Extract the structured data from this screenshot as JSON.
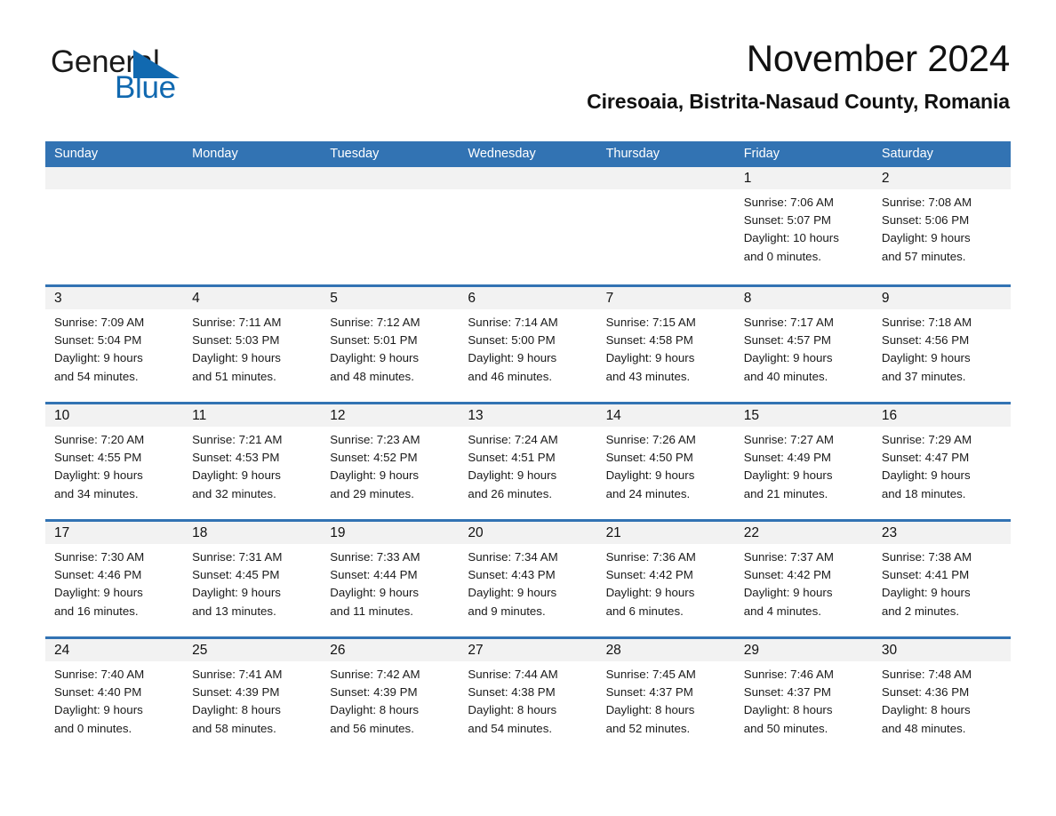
{
  "brand": {
    "word1": "General",
    "word2": "Blue",
    "triangle_color": "#1169b0",
    "word1_color": "#1a1a1a",
    "word2_color": "#1169b0",
    "icon": "general-blue-logo"
  },
  "header": {
    "month_title": "November 2024",
    "location": "Ciresoaia, Bistrita-Nasaud County, Romania"
  },
  "theme": {
    "accent": "#3273b3",
    "header_text": "#ffffff",
    "date_band": "#f2f2f2",
    "body_bg": "#ffffff",
    "text": "#1a1a1a"
  },
  "weekdays": [
    "Sunday",
    "Monday",
    "Tuesday",
    "Wednesday",
    "Thursday",
    "Friday",
    "Saturday"
  ],
  "weeks": [
    [
      {
        "empty": true
      },
      {
        "empty": true
      },
      {
        "empty": true
      },
      {
        "empty": true
      },
      {
        "empty": true
      },
      {
        "day": "1",
        "sunrise": "Sunrise: 7:06 AM",
        "sunset": "Sunset: 5:07 PM",
        "daylight_1": "Daylight: 10 hours",
        "daylight_2": "and 0 minutes."
      },
      {
        "day": "2",
        "sunrise": "Sunrise: 7:08 AM",
        "sunset": "Sunset: 5:06 PM",
        "daylight_1": "Daylight: 9 hours",
        "daylight_2": "and 57 minutes."
      }
    ],
    [
      {
        "day": "3",
        "sunrise": "Sunrise: 7:09 AM",
        "sunset": "Sunset: 5:04 PM",
        "daylight_1": "Daylight: 9 hours",
        "daylight_2": "and 54 minutes."
      },
      {
        "day": "4",
        "sunrise": "Sunrise: 7:11 AM",
        "sunset": "Sunset: 5:03 PM",
        "daylight_1": "Daylight: 9 hours",
        "daylight_2": "and 51 minutes."
      },
      {
        "day": "5",
        "sunrise": "Sunrise: 7:12 AM",
        "sunset": "Sunset: 5:01 PM",
        "daylight_1": "Daylight: 9 hours",
        "daylight_2": "and 48 minutes."
      },
      {
        "day": "6",
        "sunrise": "Sunrise: 7:14 AM",
        "sunset": "Sunset: 5:00 PM",
        "daylight_1": "Daylight: 9 hours",
        "daylight_2": "and 46 minutes."
      },
      {
        "day": "7",
        "sunrise": "Sunrise: 7:15 AM",
        "sunset": "Sunset: 4:58 PM",
        "daylight_1": "Daylight: 9 hours",
        "daylight_2": "and 43 minutes."
      },
      {
        "day": "8",
        "sunrise": "Sunrise: 7:17 AM",
        "sunset": "Sunset: 4:57 PM",
        "daylight_1": "Daylight: 9 hours",
        "daylight_2": "and 40 minutes."
      },
      {
        "day": "9",
        "sunrise": "Sunrise: 7:18 AM",
        "sunset": "Sunset: 4:56 PM",
        "daylight_1": "Daylight: 9 hours",
        "daylight_2": "and 37 minutes."
      }
    ],
    [
      {
        "day": "10",
        "sunrise": "Sunrise: 7:20 AM",
        "sunset": "Sunset: 4:55 PM",
        "daylight_1": "Daylight: 9 hours",
        "daylight_2": "and 34 minutes."
      },
      {
        "day": "11",
        "sunrise": "Sunrise: 7:21 AM",
        "sunset": "Sunset: 4:53 PM",
        "daylight_1": "Daylight: 9 hours",
        "daylight_2": "and 32 minutes."
      },
      {
        "day": "12",
        "sunrise": "Sunrise: 7:23 AM",
        "sunset": "Sunset: 4:52 PM",
        "daylight_1": "Daylight: 9 hours",
        "daylight_2": "and 29 minutes."
      },
      {
        "day": "13",
        "sunrise": "Sunrise: 7:24 AM",
        "sunset": "Sunset: 4:51 PM",
        "daylight_1": "Daylight: 9 hours",
        "daylight_2": "and 26 minutes."
      },
      {
        "day": "14",
        "sunrise": "Sunrise: 7:26 AM",
        "sunset": "Sunset: 4:50 PM",
        "daylight_1": "Daylight: 9 hours",
        "daylight_2": "and 24 minutes."
      },
      {
        "day": "15",
        "sunrise": "Sunrise: 7:27 AM",
        "sunset": "Sunset: 4:49 PM",
        "daylight_1": "Daylight: 9 hours",
        "daylight_2": "and 21 minutes."
      },
      {
        "day": "16",
        "sunrise": "Sunrise: 7:29 AM",
        "sunset": "Sunset: 4:47 PM",
        "daylight_1": "Daylight: 9 hours",
        "daylight_2": "and 18 minutes."
      }
    ],
    [
      {
        "day": "17",
        "sunrise": "Sunrise: 7:30 AM",
        "sunset": "Sunset: 4:46 PM",
        "daylight_1": "Daylight: 9 hours",
        "daylight_2": "and 16 minutes."
      },
      {
        "day": "18",
        "sunrise": "Sunrise: 7:31 AM",
        "sunset": "Sunset: 4:45 PM",
        "daylight_1": "Daylight: 9 hours",
        "daylight_2": "and 13 minutes."
      },
      {
        "day": "19",
        "sunrise": "Sunrise: 7:33 AM",
        "sunset": "Sunset: 4:44 PM",
        "daylight_1": "Daylight: 9 hours",
        "daylight_2": "and 11 minutes."
      },
      {
        "day": "20",
        "sunrise": "Sunrise: 7:34 AM",
        "sunset": "Sunset: 4:43 PM",
        "daylight_1": "Daylight: 9 hours",
        "daylight_2": "and 9 minutes."
      },
      {
        "day": "21",
        "sunrise": "Sunrise: 7:36 AM",
        "sunset": "Sunset: 4:42 PM",
        "daylight_1": "Daylight: 9 hours",
        "daylight_2": "and 6 minutes."
      },
      {
        "day": "22",
        "sunrise": "Sunrise: 7:37 AM",
        "sunset": "Sunset: 4:42 PM",
        "daylight_1": "Daylight: 9 hours",
        "daylight_2": "and 4 minutes."
      },
      {
        "day": "23",
        "sunrise": "Sunrise: 7:38 AM",
        "sunset": "Sunset: 4:41 PM",
        "daylight_1": "Daylight: 9 hours",
        "daylight_2": "and 2 minutes."
      }
    ],
    [
      {
        "day": "24",
        "sunrise": "Sunrise: 7:40 AM",
        "sunset": "Sunset: 4:40 PM",
        "daylight_1": "Daylight: 9 hours",
        "daylight_2": "and 0 minutes."
      },
      {
        "day": "25",
        "sunrise": "Sunrise: 7:41 AM",
        "sunset": "Sunset: 4:39 PM",
        "daylight_1": "Daylight: 8 hours",
        "daylight_2": "and 58 minutes."
      },
      {
        "day": "26",
        "sunrise": "Sunrise: 7:42 AM",
        "sunset": "Sunset: 4:39 PM",
        "daylight_1": "Daylight: 8 hours",
        "daylight_2": "and 56 minutes."
      },
      {
        "day": "27",
        "sunrise": "Sunrise: 7:44 AM",
        "sunset": "Sunset: 4:38 PM",
        "daylight_1": "Daylight: 8 hours",
        "daylight_2": "and 54 minutes."
      },
      {
        "day": "28",
        "sunrise": "Sunrise: 7:45 AM",
        "sunset": "Sunset: 4:37 PM",
        "daylight_1": "Daylight: 8 hours",
        "daylight_2": "and 52 minutes."
      },
      {
        "day": "29",
        "sunrise": "Sunrise: 7:46 AM",
        "sunset": "Sunset: 4:37 PM",
        "daylight_1": "Daylight: 8 hours",
        "daylight_2": "and 50 minutes."
      },
      {
        "day": "30",
        "sunrise": "Sunrise: 7:48 AM",
        "sunset": "Sunset: 4:36 PM",
        "daylight_1": "Daylight: 8 hours",
        "daylight_2": "and 48 minutes."
      }
    ]
  ]
}
